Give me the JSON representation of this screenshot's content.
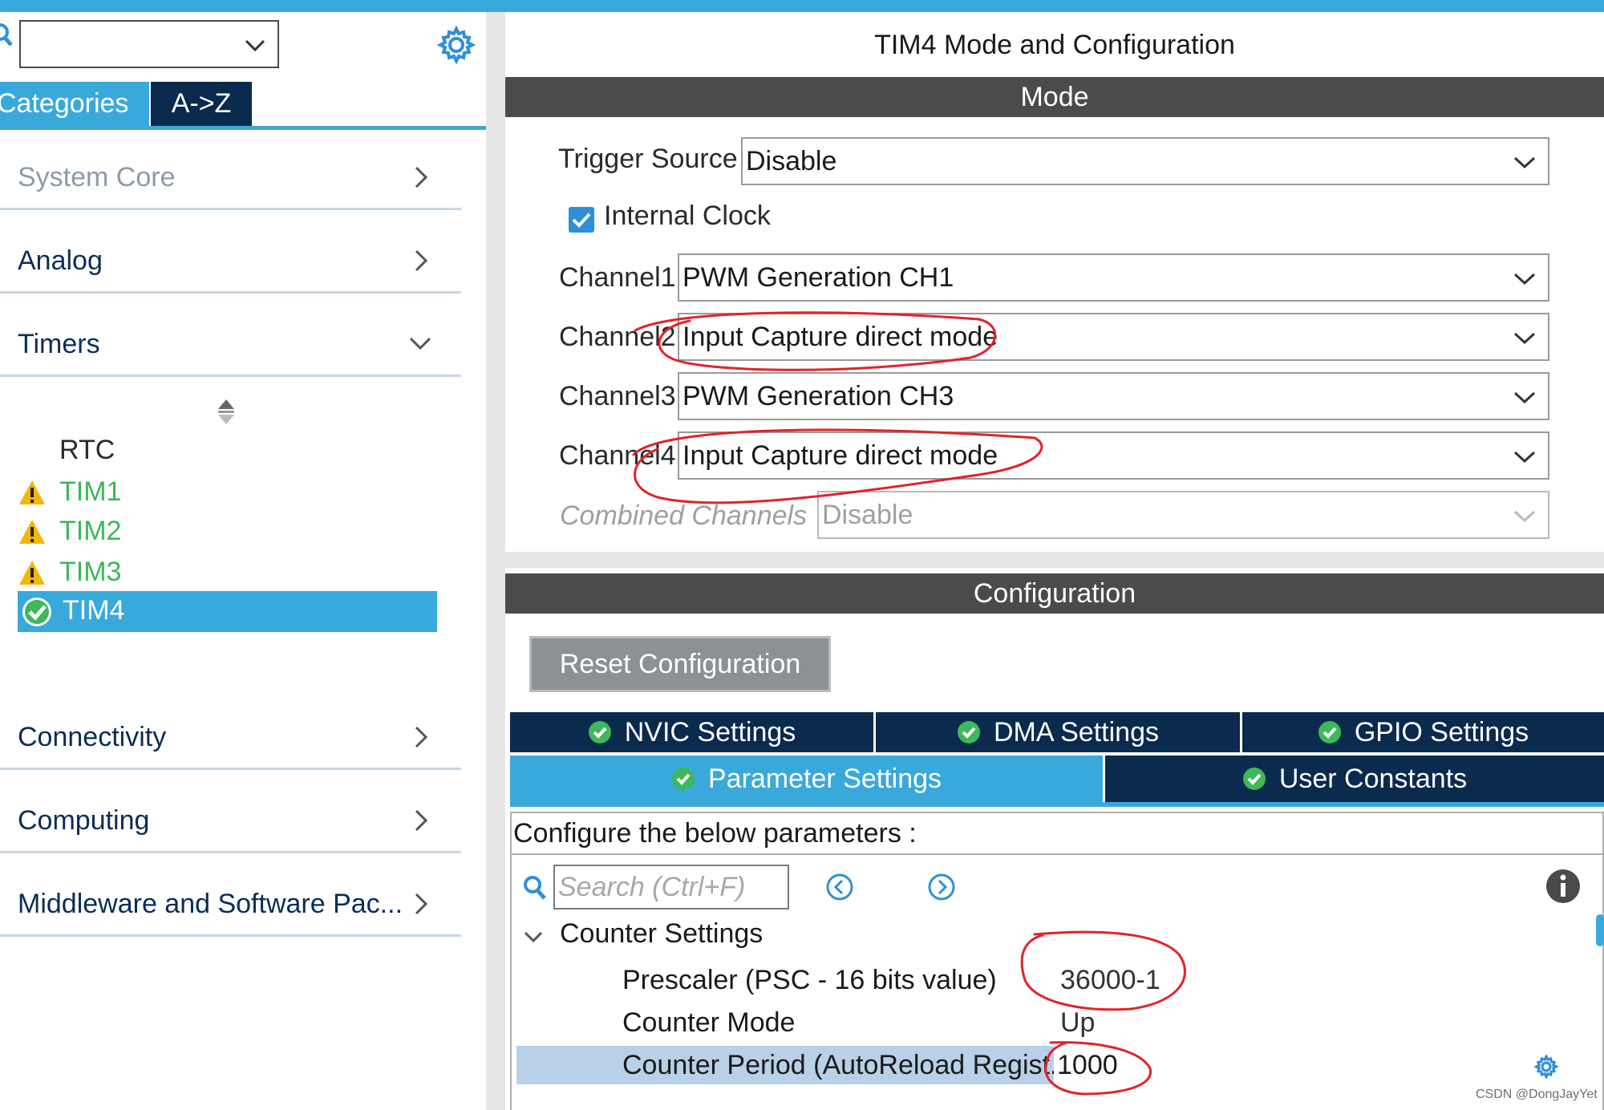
{
  "left_panel": {
    "category_select_value": "",
    "tabs": {
      "categories": "Categories",
      "az": "A->Z"
    },
    "categories": [
      {
        "label": "System Core",
        "dim": true
      },
      {
        "label": "Analog"
      },
      {
        "label": "Timers",
        "expanded": true
      },
      {
        "label": "Connectivity"
      },
      {
        "label": "Computing"
      },
      {
        "label": "Middleware and Software Pac..."
      }
    ],
    "timers": [
      {
        "label": "RTC",
        "status": "none"
      },
      {
        "label": "TIM1",
        "status": "warning"
      },
      {
        "label": "TIM2",
        "status": "warning"
      },
      {
        "label": "TIM3",
        "status": "warning"
      },
      {
        "label": "TIM4",
        "status": "ok",
        "selected": true
      }
    ]
  },
  "main": {
    "title": "TIM4 Mode and Configuration",
    "mode_header": "Mode",
    "mode": {
      "trigger_source": {
        "label": "Trigger Source",
        "value": "Disable"
      },
      "internal_clock": {
        "label": "Internal Clock",
        "checked": true
      },
      "channel1": {
        "label": "Channel1",
        "value": "PWM Generation CH1"
      },
      "channel2": {
        "label": "Channel2",
        "value": "Input Capture direct mode"
      },
      "channel3": {
        "label": "Channel3",
        "value": "PWM Generation CH3"
      },
      "channel4": {
        "label": "Channel4",
        "value": "Input Capture direct mode"
      },
      "combined_channels": {
        "label": "Combined Channels",
        "value": "Disable",
        "disabled": true
      }
    },
    "config_header": "Configuration",
    "reset_button": "Reset Configuration",
    "config_tabs": {
      "nvic": "NVIC Settings",
      "dma": "DMA Settings",
      "gpio": "GPIO Settings",
      "parameter": "Parameter Settings",
      "user_constants": "User Constants"
    },
    "params": {
      "description": "Configure the below parameters :",
      "search_placeholder": "Search (Ctrl+F)",
      "group": "Counter Settings",
      "rows": [
        {
          "key": "Prescaler (PSC - 16 bits value)",
          "value": "36000-1"
        },
        {
          "key": "Counter Mode",
          "value": "Up"
        },
        {
          "key": "Counter Period (AutoReload Regist...",
          "value": "1000",
          "selected": true
        }
      ]
    }
  },
  "watermark": "CSDN @DongJayYet",
  "colors": {
    "accent": "#39a9dc",
    "navy": "#0a2a4e",
    "header_gray": "#4b4b4b",
    "warning": "#f2b705",
    "ok_green": "#3db85a",
    "annotation_red": "#e0242a"
  },
  "icons": [
    "search-icon",
    "gear-icon",
    "chevron-down-icon",
    "chevron-right-icon",
    "warning-icon",
    "check-circle-icon",
    "info-icon",
    "prev-icon",
    "next-icon"
  ]
}
